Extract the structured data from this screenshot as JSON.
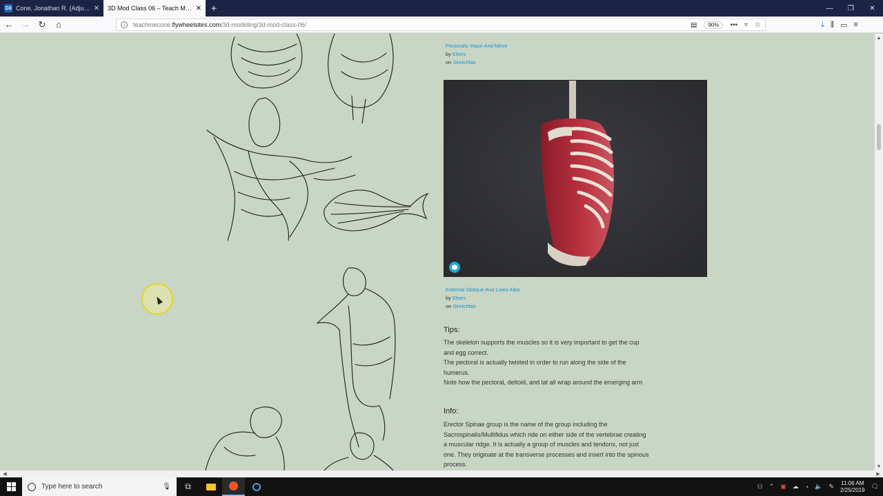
{
  "tabs": [
    {
      "label": "Cone, Jonathan R. (Adjunct) - ",
      "favicon": "O3",
      "active": false
    },
    {
      "label": "3D Mod Class 06 – Teach Me Cone",
      "active": true
    }
  ],
  "window_controls": {
    "minimize": "—",
    "restore": "❐",
    "close": "✕"
  },
  "nav": {
    "back": "←",
    "forward": "→",
    "reload": "↻",
    "home": "⌂",
    "url_prefix": "teachmecone.",
    "url_host": "flywheelsites.com",
    "url_path": "/3d-modeling/3d-mod-class-06/",
    "zoom": "90%"
  },
  "page": {
    "credit1": {
      "title": "Pectoralis Major And Minor",
      "by_label": "by",
      "author": "Ebers",
      "on_label": "on",
      "platform": "Sketchfab"
    },
    "credit2": {
      "title": "External Oblique And Linea Alba",
      "by_label": "by",
      "author": "Ebers",
      "on_label": "on",
      "platform": "Sketchfab"
    },
    "tips_title": "Tips:",
    "tips": [
      "The skeleton supports the muscles so it is very important to get the cup",
      "and egg correct.",
      "The pectoral is actually twisted in order to run along the side of the",
      "humerus.",
      "Note how the pectoral, deltoid, and lat all wrap around the emerging arm"
    ],
    "info_title": "Info:",
    "info": [
      "Erector Spinae group is the name of the group including the",
      "Sacrospinalis/Multifidus which ride on either side of the vertebrae creating",
      "a muscular ridge. It is actually a group of muscles and tendons, not just",
      "one. They originate at the transverse processes and insert into the spinous",
      "process."
    ]
  },
  "taskbar": {
    "search_placeholder": "Type here to search",
    "time": "11:06 AM",
    "date": "2/25/2019"
  },
  "colors": {
    "page_bg": "#c9d6c5",
    "link": "#1a95d4",
    "tabbar": "#1c2446"
  }
}
